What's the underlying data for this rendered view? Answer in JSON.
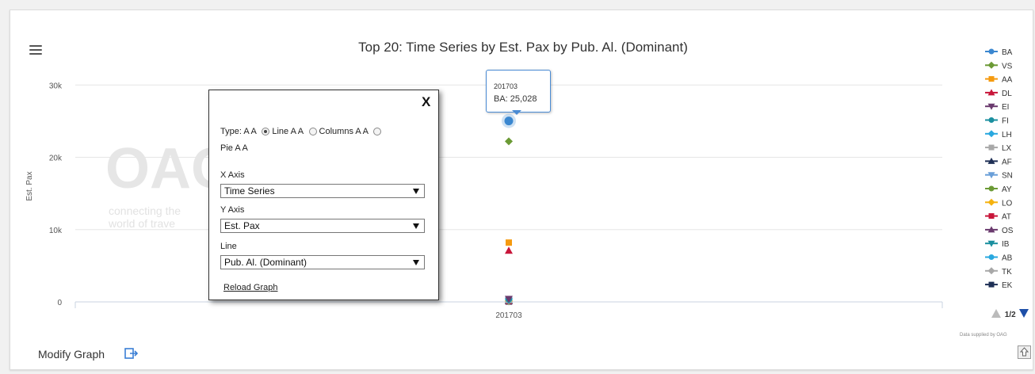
{
  "chart_data": {
    "type": "scatter",
    "title": "Top 20: Time Series by Est. Pax by Pub. Al. (Dominant)",
    "xlabel": "",
    "ylabel": "Est. Pax",
    "categories": [
      "201703"
    ],
    "ylim": [
      0,
      32000
    ],
    "yticks": [
      0,
      10000,
      20000,
      30000
    ],
    "ytick_labels": [
      "0",
      "10k",
      "20k",
      "30k"
    ],
    "grid": true,
    "legend_position": "right",
    "series": [
      {
        "name": "BA",
        "values": [
          25028
        ],
        "color": "#3a87d0",
        "marker": "circle"
      },
      {
        "name": "VS",
        "values": [
          22200
        ],
        "color": "#6b9a35",
        "marker": "diamond"
      },
      {
        "name": "AA",
        "values": [
          8200
        ],
        "color": "#f59a0f",
        "marker": "square"
      },
      {
        "name": "DL",
        "values": [
          7100
        ],
        "color": "#c8163a",
        "marker": "triangle"
      },
      {
        "name": "EI",
        "values": [
          400
        ],
        "color": "#6a3a6e",
        "marker": "triangle-down"
      },
      {
        "name": "FI",
        "values": [
          350
        ],
        "color": "#1a8f9f",
        "marker": "circle"
      },
      {
        "name": "LH",
        "values": [
          300
        ],
        "color": "#29a8df",
        "marker": "diamond"
      },
      {
        "name": "LX",
        "values": [
          250
        ],
        "color": "#a8a8a8",
        "marker": "square"
      },
      {
        "name": "AF",
        "values": [
          200
        ],
        "color": "#1e2f55",
        "marker": "triangle"
      },
      {
        "name": "SN",
        "values": [
          180
        ],
        "color": "#6a9fd8",
        "marker": "triangle-down"
      },
      {
        "name": "AY",
        "values": [
          160
        ],
        "color": "#6b9a35",
        "marker": "circle"
      },
      {
        "name": "LO",
        "values": [
          140
        ],
        "color": "#f5b20f",
        "marker": "diamond"
      },
      {
        "name": "AT",
        "values": [
          120
        ],
        "color": "#c8163a",
        "marker": "square"
      },
      {
        "name": "OS",
        "values": [
          100
        ],
        "color": "#6a3a6e",
        "marker": "triangle"
      },
      {
        "name": "IB",
        "values": [
          90
        ],
        "color": "#1a8f9f",
        "marker": "triangle-down"
      },
      {
        "name": "AB",
        "values": [
          80
        ],
        "color": "#29a8df",
        "marker": "circle"
      },
      {
        "name": "TK",
        "values": [
          60
        ],
        "color": "#a8a8a8",
        "marker": "diamond"
      },
      {
        "name": "EK",
        "values": [
          50
        ],
        "color": "#1e2f55",
        "marker": "square"
      }
    ]
  },
  "tooltip": {
    "x": "201703",
    "value_text": "BA: 25,028"
  },
  "watermark": {
    "logo": "OAG",
    "tagline_1": "connecting the",
    "tagline_2": "world of trave"
  },
  "legend_pager": {
    "text": "1/2"
  },
  "footer": {
    "modify_label": "Modify Graph",
    "source_note": "Data supplied by OAG"
  },
  "dialog": {
    "close_label": "X",
    "type_label": "Type: A A",
    "option_line": "Line A A",
    "option_columns": "Columns A A",
    "option_pie": "Pie A A",
    "x_axis_label": "X Axis",
    "x_axis_value": "Time Series",
    "y_axis_label": "Y Axis",
    "y_axis_value": "Est. Pax",
    "line_label": "Line",
    "line_value": "Pub. Al. (Dominant)",
    "reload_label": "Reload Graph"
  },
  "icons": {
    "menu": "hamburger-icon",
    "modify": "external-panel-icon",
    "upload": "upload-icon",
    "pager_up": "triangle-up-icon",
    "pager_down": "triangle-down-icon"
  }
}
